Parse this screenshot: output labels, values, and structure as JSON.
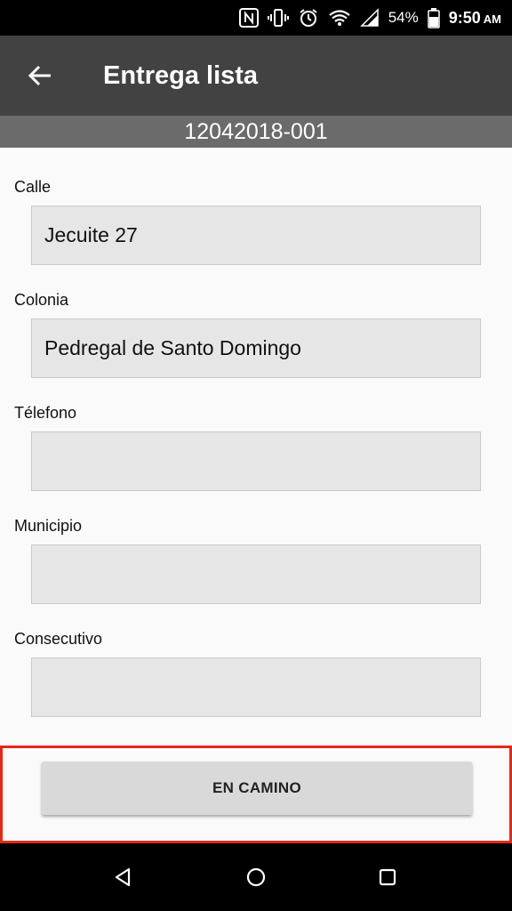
{
  "status_bar": {
    "battery_percent": "54%",
    "time": "9:50",
    "ampm": "AM",
    "icons": [
      "nfc-icon",
      "vibrate-icon",
      "alarm-icon",
      "wifi-icon",
      "signal-icon",
      "battery-icon"
    ]
  },
  "app_bar": {
    "title": "Entrega lista",
    "back_icon": "arrow-back-icon"
  },
  "subheader": {
    "order_id": "12042018-001"
  },
  "form": {
    "fields": [
      {
        "label": "Calle",
        "value": "Jecuite 27"
      },
      {
        "label": "Colonia",
        "value": "Pedregal de Santo Domingo"
      },
      {
        "label": "Télefono",
        "value": ""
      },
      {
        "label": "Municipio",
        "value": ""
      },
      {
        "label": "Consecutivo",
        "value": ""
      }
    ]
  },
  "action": {
    "button_label": "EN CAMINO",
    "highlight_color": "#e02a1a"
  },
  "nav_bar": {
    "buttons": [
      "back-triangle-icon",
      "home-circle-icon",
      "recents-square-icon"
    ]
  },
  "colors": {
    "app_bar": "#424242",
    "subheader": "#6b6b6b",
    "input_bg": "#e6e6e6"
  }
}
